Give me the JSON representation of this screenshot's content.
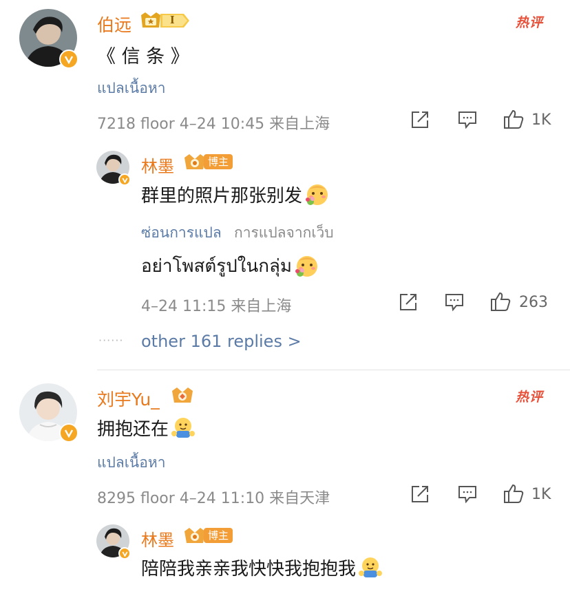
{
  "comments": [
    {
      "author": "伯远",
      "level_badge": "I",
      "hot_label": "热评",
      "text": "《 信 条 》",
      "translate_label": "แปลเนื้อหา",
      "meta": "7218 floor  4–24 10:45  来自上海",
      "like_count": "1K",
      "reply": {
        "author": "林墨",
        "badge": "博主",
        "text": "群里的照片那张别发",
        "hide_translation_label": "ซ่อนการแปล",
        "translation_source": "การแปลจากเว็บ",
        "translated_text": "อย่าโพสต์รูปในกลุ่ม",
        "meta": "4–24 11:15  来自上海",
        "like_count": "263"
      },
      "more_replies": "other 161 replies >"
    },
    {
      "author": "刘宇Yu_",
      "hot_label": "热评",
      "text": "拥抱还在",
      "translate_label": "แปลเนื้อหา",
      "meta": "8295 floor  4–24 11:10  来自天津",
      "like_count": "1K",
      "reply": {
        "author": "林墨",
        "badge": "博主",
        "text": "陪陪我亲亲我快快我抱抱我"
      }
    }
  ],
  "dots": "······",
  "colors": {
    "name": "#e8791c",
    "link": "#5b7ba6",
    "meta": "#8a8a8a",
    "hot": "#e7513a",
    "badge": "#f29d36"
  },
  "icons": [
    "share-icon",
    "comment-icon",
    "like-icon",
    "verified-icon",
    "crown-icon",
    "bouquet-emoji",
    "hug-emoji"
  ]
}
